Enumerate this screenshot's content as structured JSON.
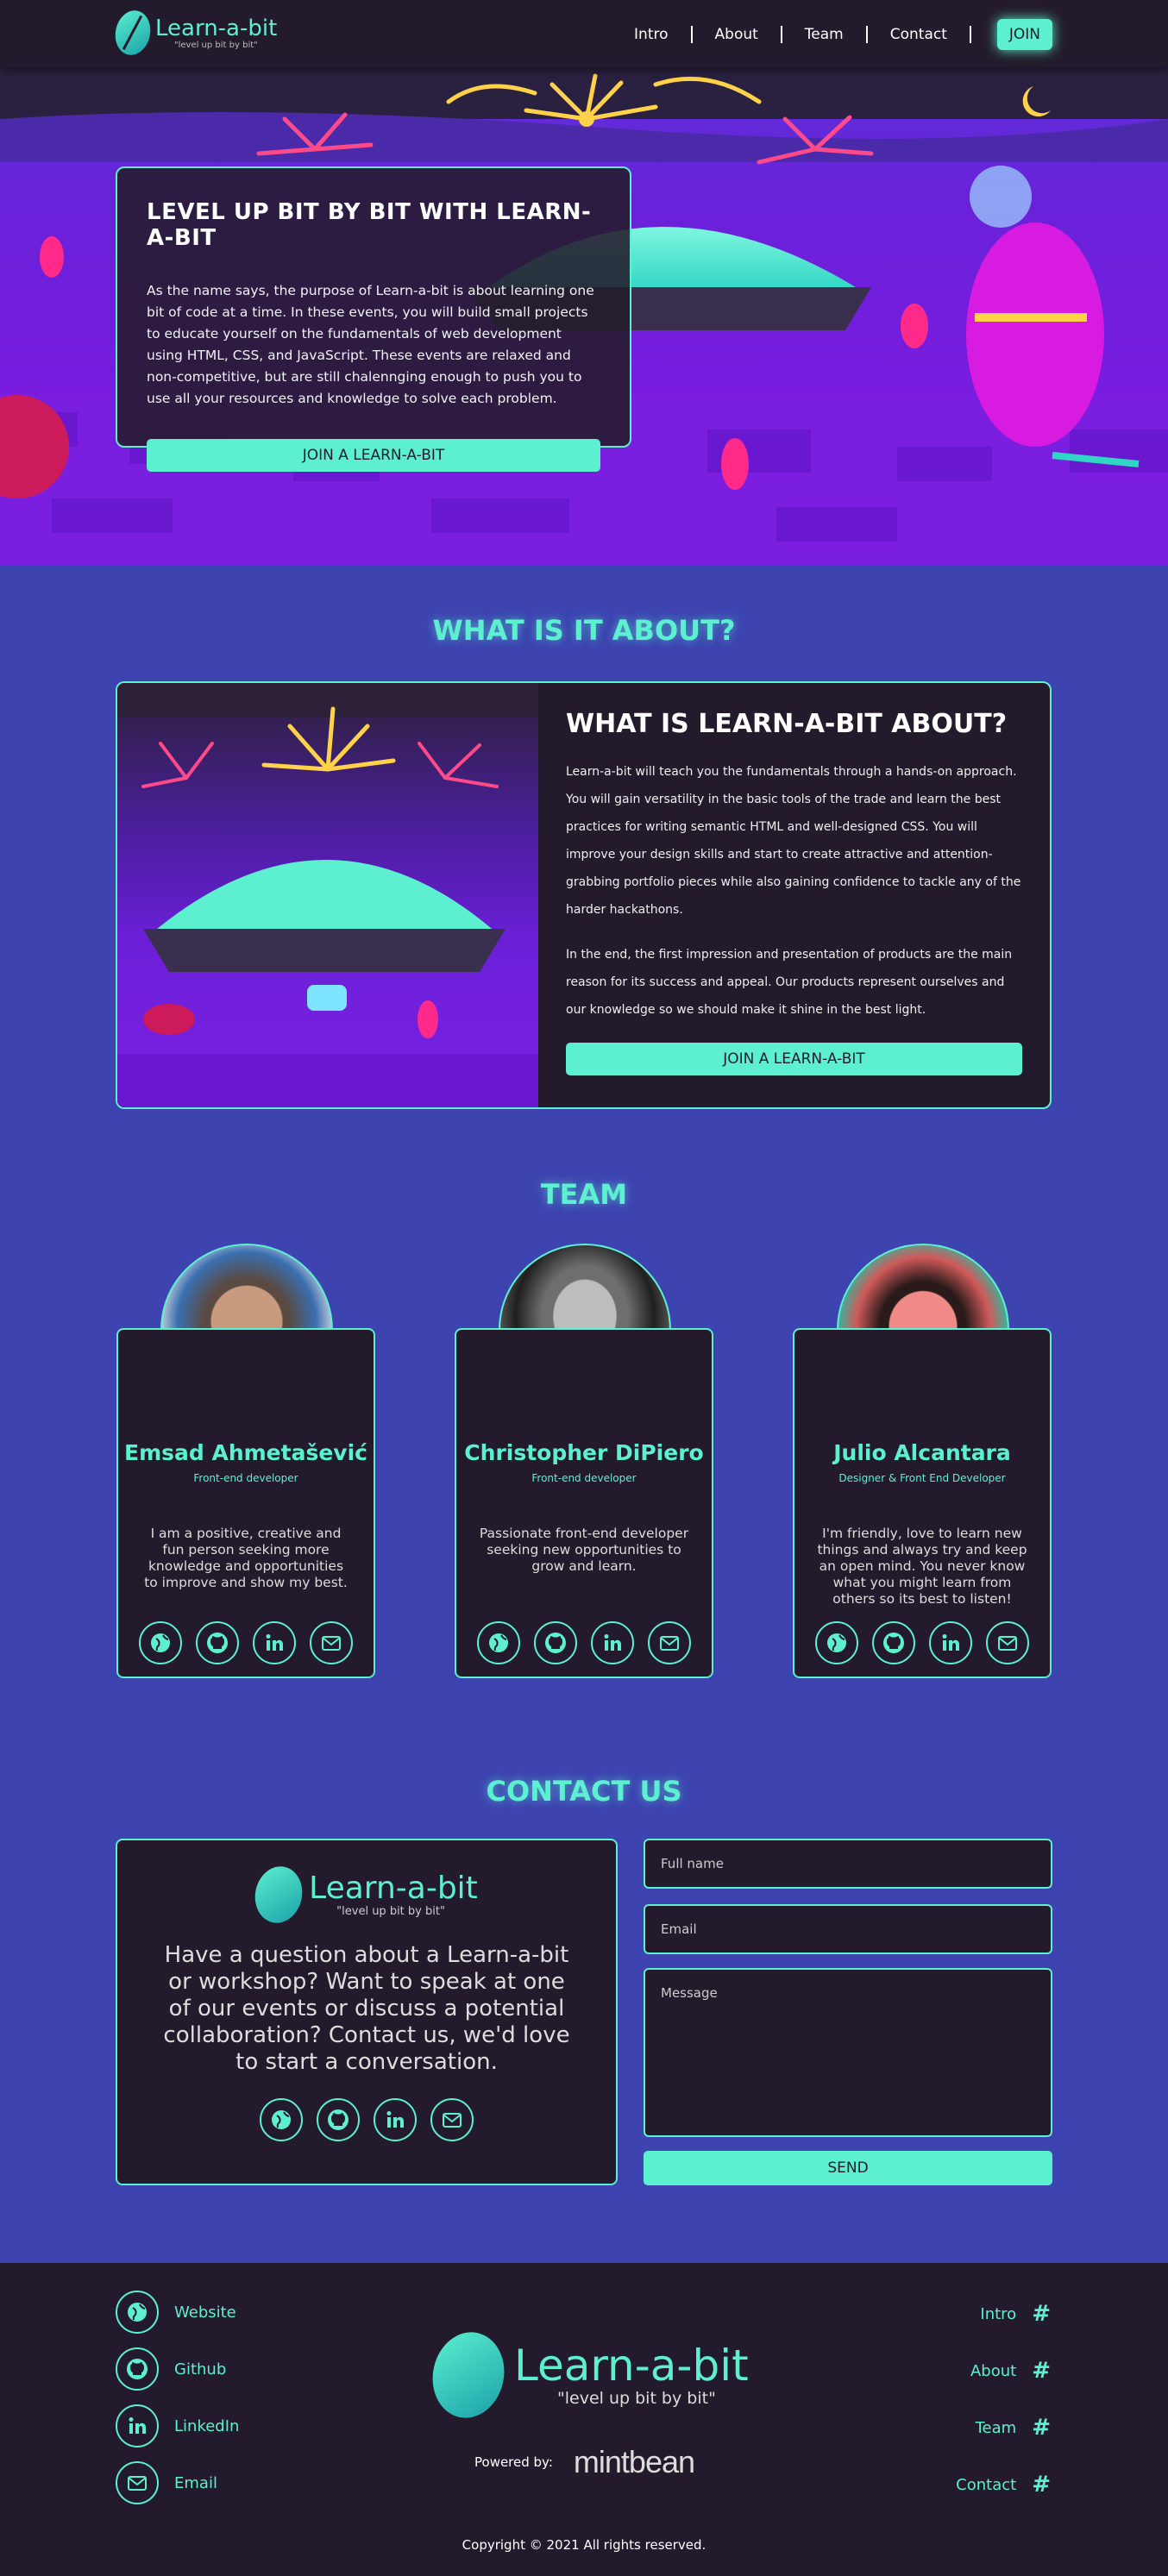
{
  "brand": {
    "name": "Learn-a-bit",
    "tagline": "\"level up bit by bit\""
  },
  "nav": {
    "items": [
      "Intro",
      "About",
      "Team",
      "Contact"
    ],
    "join": "JOIN"
  },
  "hero": {
    "title": "LEVEL UP BIT BY BIT WITH LEARN-A-BIT",
    "text": "As the name says, the purpose of Learn-a-bit is about learning one bit of code at a time. In these events, you will build small projects to educate yourself on the fundamentals of web development using HTML, CSS, and JavaScript. These events are relaxed and non-competitive, but are still chalennging enough to push you to use all your resources and knowledge to solve each problem.",
    "button": "JOIN A LEARN-A-BIT"
  },
  "about": {
    "section_title": "WHAT IS IT ABOUT?",
    "title": "WHAT IS LEARN-A-BIT ABOUT?",
    "p1": "Learn-a-bit will teach you the fundamentals through a hands-on approach. You will gain versatility in the basic tools of the trade and learn the best practices for writing semantic HTML and well-designed CSS. You will improve your design skills and start to create attractive and attention-grabbing portfolio pieces while also gaining confidence to tackle any of the harder hackathons.",
    "p2": "In the end, the first impression and presentation of products are the main reason for its success and appeal. Our products represent ourselves and our knowledge so we should make it shine in the best light.",
    "button": "JOIN A LEARN-A-BIT"
  },
  "team": {
    "section_title": "TEAM",
    "members": [
      {
        "name": "Emsad Ahmetašević",
        "role": "Front-end developer",
        "bio": "I am a positive, creative and fun person seeking more knowledge and opportunities to improve and show my best."
      },
      {
        "name": "Christopher DiPiero",
        "role": "Front-end developer",
        "bio": "Passionate front-end developer seeking new opportunities to grow and learn."
      },
      {
        "name": "Julio Alcantara",
        "role": "Designer & Front End Developer",
        "bio": "I'm friendly, love to learn new things and always try and keep an open mind. You never know what you might learn from others so its best to listen!"
      }
    ]
  },
  "contact": {
    "section_title": "CONTACT US",
    "text": "Have a question about a Learn-a-bit or workshop? Want to speak at one of our events or discuss a potential collaboration? Contact us, we'd love to start a conversation.",
    "fullname_placeholder": "Full name",
    "email_placeholder": "Email",
    "message_placeholder": "Message",
    "send": "SEND"
  },
  "footer": {
    "links": [
      "Website",
      "Github",
      "LinkedIn",
      "Email"
    ],
    "nav": [
      "Intro",
      "About",
      "Team",
      "Contact"
    ],
    "hash": "#",
    "powered_by": "Powered by:",
    "sponsor": "mintbean",
    "copyright": "Copyright © 2021 All rights reserved."
  },
  "colors": {
    "accent": "#5cf0d0",
    "dark": "#231b2b",
    "background": "#3d44b0"
  }
}
